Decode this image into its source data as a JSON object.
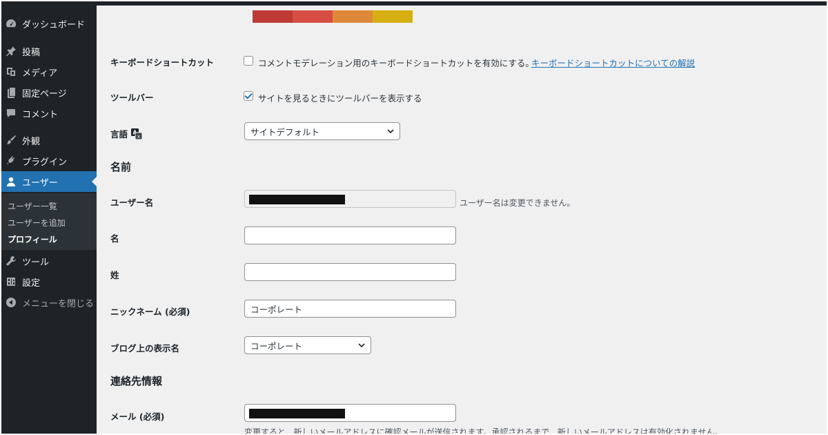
{
  "sidebar": {
    "items": [
      {
        "label": "ダッシュボード",
        "icon": "dashboard-icon"
      },
      {
        "label": "投稿",
        "icon": "pin-icon"
      },
      {
        "label": "メディア",
        "icon": "media-icon"
      },
      {
        "label": "固定ページ",
        "icon": "page-icon"
      },
      {
        "label": "コメント",
        "icon": "comment-icon"
      },
      {
        "label": "外観",
        "icon": "brush-icon"
      },
      {
        "label": "プラグイン",
        "icon": "plugin-icon"
      },
      {
        "label": "ユーザー",
        "icon": "user-icon"
      },
      {
        "label": "ツール",
        "icon": "wrench-icon"
      },
      {
        "label": "設定",
        "icon": "settings-icon"
      },
      {
        "label": "メニューを閉じる",
        "icon": "collapse-icon"
      }
    ],
    "submenu": [
      "ユーザー一覧",
      "ユーザーを追加",
      "プロフィール"
    ]
  },
  "color_scheme_swatches": [
    "#be3b35",
    "#d64d43",
    "#e0883a",
    "#d6b012"
  ],
  "form": {
    "keyboard_shortcuts": {
      "label": "キーボードショートカット",
      "option": "コメントモデレーション用のキーボードショートカットを有効にする。",
      "link": "キーボードショートカットについての解説",
      "checked": false
    },
    "toolbar": {
      "label": "ツールバー",
      "option": "サイトを見るときにツールバーを表示する",
      "checked": true
    },
    "language": {
      "label": "言語",
      "value": "サイトデフォルト"
    },
    "name_section": "名前",
    "username": {
      "label": "ユーザー名",
      "note": "ユーザー名は変更できません。"
    },
    "first_name": {
      "label": "名",
      "value": ""
    },
    "last_name": {
      "label": "姓",
      "value": ""
    },
    "nickname": {
      "label": "ニックネーム",
      "required": "(必須)",
      "value": "コーポレート"
    },
    "display_name": {
      "label": "ブログ上の表示名",
      "value": "コーポレート"
    },
    "contact_section": "連絡先情報",
    "email": {
      "label": "メール",
      "required": "(必須)",
      "note": "変更すると、新しいメールアドレスに確認メールが送信されます。承認されるまで、新しいメールアドレスは有効化されません。"
    }
  }
}
